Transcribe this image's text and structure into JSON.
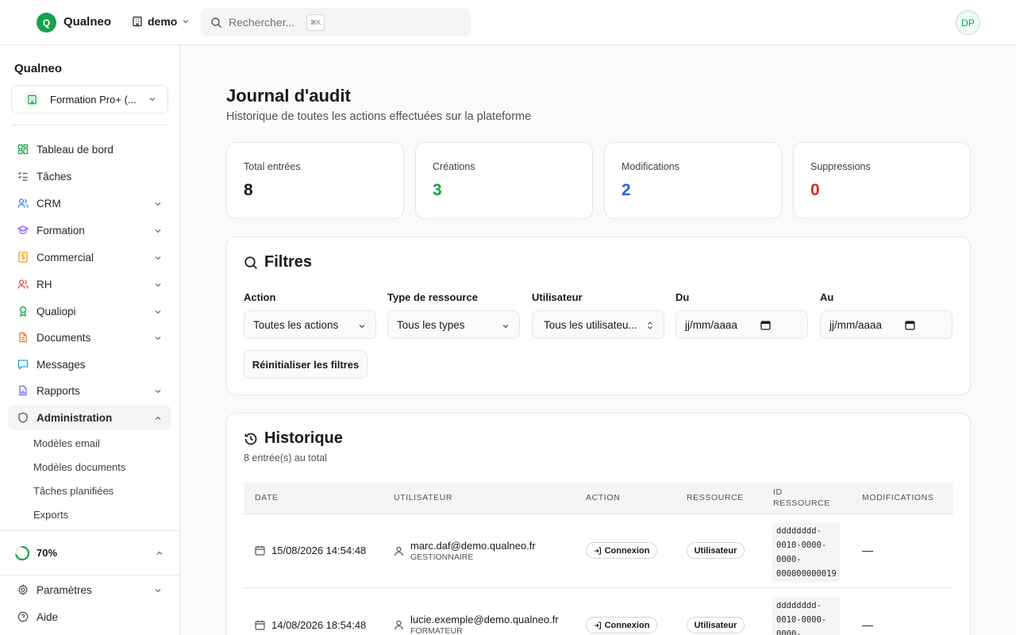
{
  "topbar": {
    "logo_letter": "Q",
    "app_name": "Qualneo",
    "org_name": "demo",
    "search_placeholder": "Rechercher...",
    "search_shortcut": "⌘K",
    "avatar_initials": "DP"
  },
  "sidebar": {
    "brand": "Qualneo",
    "org_selector": "Formation Pro+ (...",
    "items": [
      {
        "label": "Tableau de bord",
        "icon": "dashboard-icon",
        "color": "#16a34a"
      },
      {
        "label": "Tâches",
        "icon": "tasks-icon",
        "color": "#57534e"
      },
      {
        "label": "CRM",
        "icon": "users-icon",
        "color": "#3b82f6"
      },
      {
        "label": "Formation",
        "icon": "graduation-cap-icon",
        "color": "#8b5cf6"
      },
      {
        "label": "Commercial",
        "icon": "dollar-icon",
        "color": "#f59e0b"
      },
      {
        "label": "RH",
        "icon": "people-icon",
        "color": "#ef4444"
      },
      {
        "label": "Qualiopi",
        "icon": "award-icon",
        "color": "#16a34a"
      },
      {
        "label": "Documents",
        "icon": "document-icon",
        "color": "#f97316"
      },
      {
        "label": "Messages",
        "icon": "message-icon",
        "color": "#0ea5e9"
      },
      {
        "label": "Rapports",
        "icon": "report-icon",
        "color": "#6366f1"
      },
      {
        "label": "Administration",
        "icon": "shield-icon",
        "color": "#57534e"
      }
    ],
    "admin_subitems": [
      "Modèles email",
      "Modèles documents",
      "Tâches planifiées",
      "Exports"
    ],
    "progress_label": "70%",
    "progress_value": 0.7,
    "settings_label": "Paramètres",
    "help_label": "Aide"
  },
  "main": {
    "title": "Journal d'audit",
    "subtitle": "Historique de toutes les actions effectuées sur la plateforme",
    "stats": [
      {
        "label": "Total entrées",
        "value": "8",
        "color": "#1c1917"
      },
      {
        "label": "Créations",
        "value": "3",
        "color": "#16a34a"
      },
      {
        "label": "Modifications",
        "value": "2",
        "color": "#2563eb"
      },
      {
        "label": "Suppressions",
        "value": "0",
        "color": "#dc2626"
      }
    ],
    "filters": {
      "title": "Filtres",
      "action_label": "Action",
      "action_value": "Toutes les actions",
      "type_label": "Type de ressource",
      "type_value": "Tous les types",
      "user_label": "Utilisateur",
      "user_value": "Tous les utilisateu...",
      "from_label": "Du",
      "from_placeholder": "jj/mm/aaaa",
      "to_label": "Au",
      "to_placeholder": "jj/mm/aaaa",
      "reset_label": "Réinitialiser les filtres"
    },
    "history": {
      "title": "Historique",
      "count_text": "8 entrée(s) au total",
      "columns": [
        "Date",
        "Utilisateur",
        "Action",
        "Ressource",
        "ID",
        "Ressource",
        "Modifications"
      ],
      "rows": [
        {
          "date": "15/08/2026 14:54:48",
          "email": "marc.daf@demo.qualneo.fr",
          "role": "GESTIONNAIRE",
          "action": "Connexion",
          "resource": "Utilisateur",
          "id_lines": [
            "dddddddd-",
            "0010-0000-",
            "0000-",
            "000000000019"
          ],
          "changes": "—"
        },
        {
          "date": "14/08/2026 18:54:48",
          "email": "lucie.exemple@demo.qualneo.fr",
          "role": "FORMATEUR",
          "action": "Connexion",
          "resource": "Utilisateur",
          "id_lines": [
            "dddddddd-",
            "0010-0000-",
            "0000-"
          ],
          "changes": "—"
        }
      ]
    }
  }
}
